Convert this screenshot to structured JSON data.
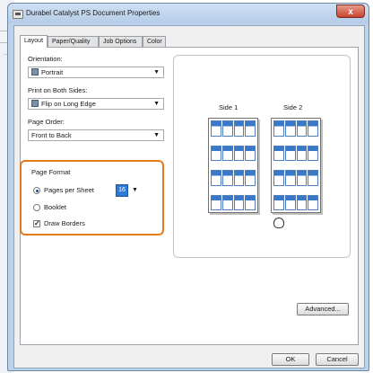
{
  "window": {
    "title": "Durabel Catalyst PS Document Properties",
    "close_glyph": "x"
  },
  "tabs": [
    {
      "label": "Layout",
      "active": true
    },
    {
      "label": "Paper/Quality",
      "active": false
    },
    {
      "label": "Job Options",
      "active": false
    },
    {
      "label": "Color",
      "active": false
    }
  ],
  "orientation": {
    "label": "Orientation:",
    "value": "Portrait",
    "icon": "page-icon"
  },
  "print_both_sides": {
    "label": "Print on Both Sides:",
    "value": "Flip on Long Edge",
    "icon": "duplex-icon"
  },
  "page_order": {
    "label": "Page Order:",
    "value": "Front to Back"
  },
  "page_format": {
    "label": "Page Format",
    "pages_per_sheet": {
      "label": "Pages per Sheet",
      "value": "16",
      "selected": true
    },
    "booklet": {
      "label": "Booklet",
      "selected": false
    },
    "draw_borders": {
      "label": "Draw Borders",
      "checked": true
    }
  },
  "preview": {
    "side1_label": "Side 1",
    "side2_label": "Side 2",
    "pages_per_side": 16
  },
  "buttons": {
    "advanced": "Advanced...",
    "ok": "OK",
    "cancel": "Cancel"
  },
  "colors": {
    "highlight": "#e57a1b",
    "selection": "#2c7bd6",
    "titlebar": "#bcd3ec"
  }
}
